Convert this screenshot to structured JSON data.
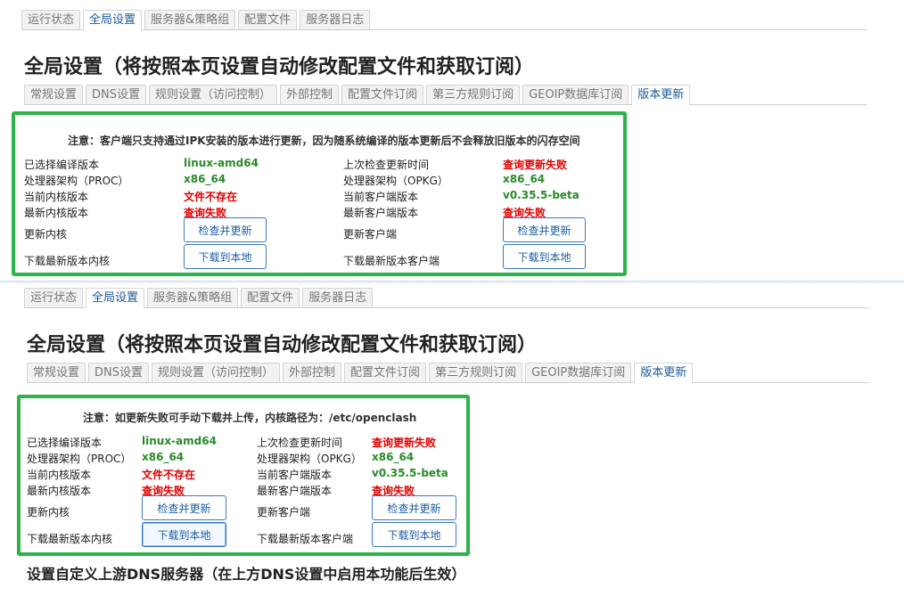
{
  "top_tabs": [
    "运行状态",
    "全局设置",
    "服务器&策略组",
    "配置文件",
    "服务器日志"
  ],
  "page_title": "全局设置（将按照本页设置自动修改配置文件和获取订阅）",
  "sub_tabs": [
    "常规设置",
    "DNS设置",
    "规则设置（访问控制）",
    "外部控制",
    "配置文件订阅",
    "第三方规则订阅",
    "GEOIP数据库订阅",
    "版本更新"
  ],
  "panel1": {
    "notice": "注意：客户端只支持通过IPK安装的版本进行更新，因为随系统编译的版本更新后不会释放旧版本的闪存空间"
  },
  "panel2": {
    "notice": "注意：如更新失败可手动下载并上传，内核路径为：/etc/openclash"
  },
  "left": {
    "compiled_label": "已选择编译版本",
    "compiled_value": "linux-amd64",
    "arch_label": "处理器架构（PROC）",
    "arch_value": "x86_64",
    "core_label": "当前内核版本",
    "core_value": "文件不存在",
    "latest_core_label": "最新内核版本",
    "latest_core_value": "查询失败",
    "update_core_label": "更新内核",
    "update_button": "检查并更新",
    "download_core_label": "下载最新版本内核",
    "download_button": "下载到本地"
  },
  "right": {
    "last_check_label": "上次检查更新时间",
    "last_check_value": "查询更新失败",
    "arch_label": "处理器架构（OPKG）",
    "arch_value": "x86_64",
    "client_label": "当前客户端版本",
    "client_value": "v0.35.5-beta",
    "latest_client_label": "最新客户端版本",
    "latest_client_value": "查询失败",
    "update_client_label": "更新客户端",
    "update_button": "检查并更新",
    "download_client_label": "下载最新版本客户端",
    "download_button": "下载到本地"
  },
  "bottom_heading": "设置自定义上游DNS服务器（在上方DNS设置中启用本功能后生效）",
  "colors": {
    "panel_border": "#2db34a",
    "ok": "#2a8a2a",
    "error": "#e00000",
    "button": "#1c5ea8"
  }
}
